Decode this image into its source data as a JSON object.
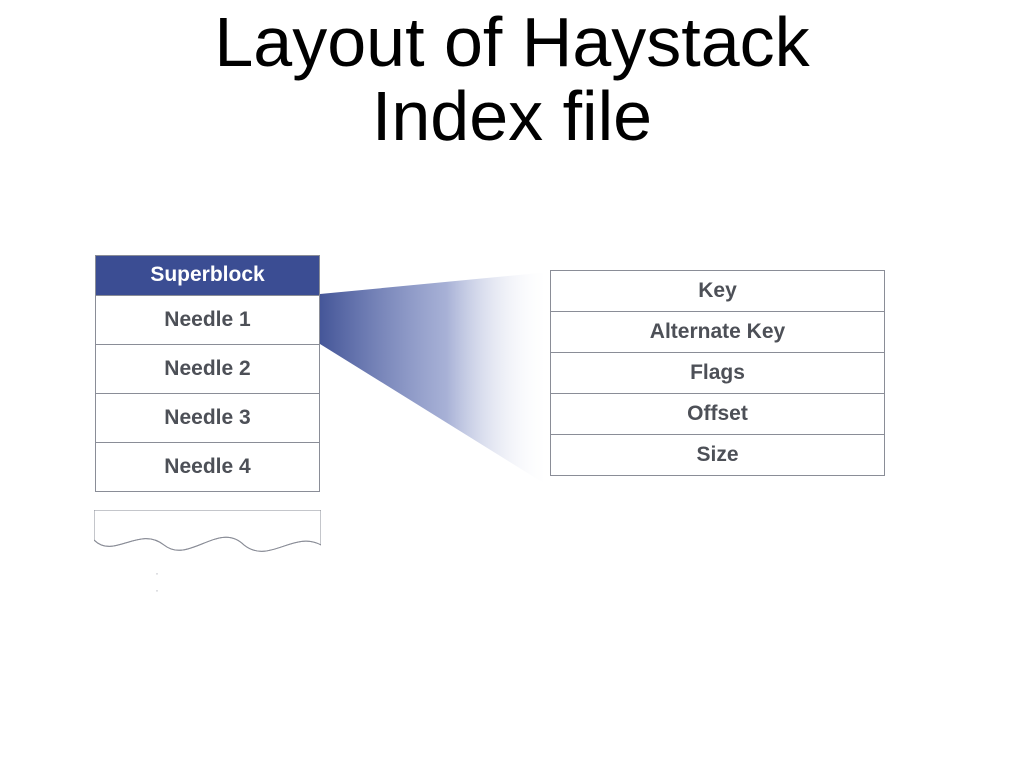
{
  "title_line1": "Layout of Haystack",
  "title_line2": "Index file",
  "left": {
    "superblock": "Superblock",
    "needles": [
      "Needle 1",
      "Needle 2",
      "Needle 3",
      "Needle 4"
    ]
  },
  "right": {
    "fields": [
      "Key",
      "Alternate Key",
      "Flags",
      "Offset",
      "Size"
    ]
  },
  "colors": {
    "header_bg": "#3b4d93",
    "border": "#8a8d97",
    "text": "#4d5057"
  }
}
